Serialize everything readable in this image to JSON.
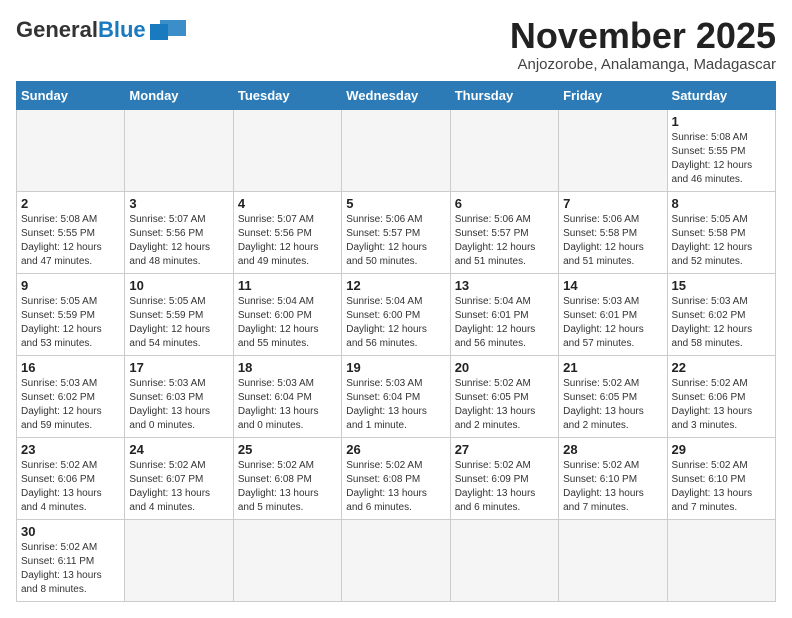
{
  "header": {
    "logo_general": "General",
    "logo_blue": "Blue",
    "month_year": "November 2025",
    "location": "Anjozorobe, Analamanga, Madagascar"
  },
  "days_of_week": [
    "Sunday",
    "Monday",
    "Tuesday",
    "Wednesday",
    "Thursday",
    "Friday",
    "Saturday"
  ],
  "weeks": [
    [
      {
        "day": "",
        "info": "",
        "empty": true
      },
      {
        "day": "",
        "info": "",
        "empty": true
      },
      {
        "day": "",
        "info": "",
        "empty": true
      },
      {
        "day": "",
        "info": "",
        "empty": true
      },
      {
        "day": "",
        "info": "",
        "empty": true
      },
      {
        "day": "",
        "info": "",
        "empty": true
      },
      {
        "day": "1",
        "info": "Sunrise: 5:08 AM\nSunset: 5:55 PM\nDaylight: 12 hours\nand 46 minutes."
      }
    ],
    [
      {
        "day": "2",
        "info": "Sunrise: 5:08 AM\nSunset: 5:55 PM\nDaylight: 12 hours\nand 47 minutes."
      },
      {
        "day": "3",
        "info": "Sunrise: 5:07 AM\nSunset: 5:56 PM\nDaylight: 12 hours\nand 48 minutes."
      },
      {
        "day": "4",
        "info": "Sunrise: 5:07 AM\nSunset: 5:56 PM\nDaylight: 12 hours\nand 49 minutes."
      },
      {
        "day": "5",
        "info": "Sunrise: 5:06 AM\nSunset: 5:57 PM\nDaylight: 12 hours\nand 50 minutes."
      },
      {
        "day": "6",
        "info": "Sunrise: 5:06 AM\nSunset: 5:57 PM\nDaylight: 12 hours\nand 51 minutes."
      },
      {
        "day": "7",
        "info": "Sunrise: 5:06 AM\nSunset: 5:58 PM\nDaylight: 12 hours\nand 51 minutes."
      },
      {
        "day": "8",
        "info": "Sunrise: 5:05 AM\nSunset: 5:58 PM\nDaylight: 12 hours\nand 52 minutes."
      }
    ],
    [
      {
        "day": "9",
        "info": "Sunrise: 5:05 AM\nSunset: 5:59 PM\nDaylight: 12 hours\nand 53 minutes."
      },
      {
        "day": "10",
        "info": "Sunrise: 5:05 AM\nSunset: 5:59 PM\nDaylight: 12 hours\nand 54 minutes."
      },
      {
        "day": "11",
        "info": "Sunrise: 5:04 AM\nSunset: 6:00 PM\nDaylight: 12 hours\nand 55 minutes."
      },
      {
        "day": "12",
        "info": "Sunrise: 5:04 AM\nSunset: 6:00 PM\nDaylight: 12 hours\nand 56 minutes."
      },
      {
        "day": "13",
        "info": "Sunrise: 5:04 AM\nSunset: 6:01 PM\nDaylight: 12 hours\nand 56 minutes."
      },
      {
        "day": "14",
        "info": "Sunrise: 5:03 AM\nSunset: 6:01 PM\nDaylight: 12 hours\nand 57 minutes."
      },
      {
        "day": "15",
        "info": "Sunrise: 5:03 AM\nSunset: 6:02 PM\nDaylight: 12 hours\nand 58 minutes."
      }
    ],
    [
      {
        "day": "16",
        "info": "Sunrise: 5:03 AM\nSunset: 6:02 PM\nDaylight: 12 hours\nand 59 minutes."
      },
      {
        "day": "17",
        "info": "Sunrise: 5:03 AM\nSunset: 6:03 PM\nDaylight: 13 hours\nand 0 minutes."
      },
      {
        "day": "18",
        "info": "Sunrise: 5:03 AM\nSunset: 6:04 PM\nDaylight: 13 hours\nand 0 minutes."
      },
      {
        "day": "19",
        "info": "Sunrise: 5:03 AM\nSunset: 6:04 PM\nDaylight: 13 hours\nand 1 minute."
      },
      {
        "day": "20",
        "info": "Sunrise: 5:02 AM\nSunset: 6:05 PM\nDaylight: 13 hours\nand 2 minutes."
      },
      {
        "day": "21",
        "info": "Sunrise: 5:02 AM\nSunset: 6:05 PM\nDaylight: 13 hours\nand 2 minutes."
      },
      {
        "day": "22",
        "info": "Sunrise: 5:02 AM\nSunset: 6:06 PM\nDaylight: 13 hours\nand 3 minutes."
      }
    ],
    [
      {
        "day": "23",
        "info": "Sunrise: 5:02 AM\nSunset: 6:06 PM\nDaylight: 13 hours\nand 4 minutes."
      },
      {
        "day": "24",
        "info": "Sunrise: 5:02 AM\nSunset: 6:07 PM\nDaylight: 13 hours\nand 4 minutes."
      },
      {
        "day": "25",
        "info": "Sunrise: 5:02 AM\nSunset: 6:08 PM\nDaylight: 13 hours\nand 5 minutes."
      },
      {
        "day": "26",
        "info": "Sunrise: 5:02 AM\nSunset: 6:08 PM\nDaylight: 13 hours\nand 6 minutes."
      },
      {
        "day": "27",
        "info": "Sunrise: 5:02 AM\nSunset: 6:09 PM\nDaylight: 13 hours\nand 6 minutes."
      },
      {
        "day": "28",
        "info": "Sunrise: 5:02 AM\nSunset: 6:10 PM\nDaylight: 13 hours\nand 7 minutes."
      },
      {
        "day": "29",
        "info": "Sunrise: 5:02 AM\nSunset: 6:10 PM\nDaylight: 13 hours\nand 7 minutes."
      }
    ],
    [
      {
        "day": "30",
        "info": "Sunrise: 5:02 AM\nSunset: 6:11 PM\nDaylight: 13 hours\nand 8 minutes.",
        "last": true
      },
      {
        "day": "",
        "info": "",
        "empty": true,
        "last": true
      },
      {
        "day": "",
        "info": "",
        "empty": true,
        "last": true
      },
      {
        "day": "",
        "info": "",
        "empty": true,
        "last": true
      },
      {
        "day": "",
        "info": "",
        "empty": true,
        "last": true
      },
      {
        "day": "",
        "info": "",
        "empty": true,
        "last": true
      },
      {
        "day": "",
        "info": "",
        "empty": true,
        "last": true
      }
    ]
  ]
}
